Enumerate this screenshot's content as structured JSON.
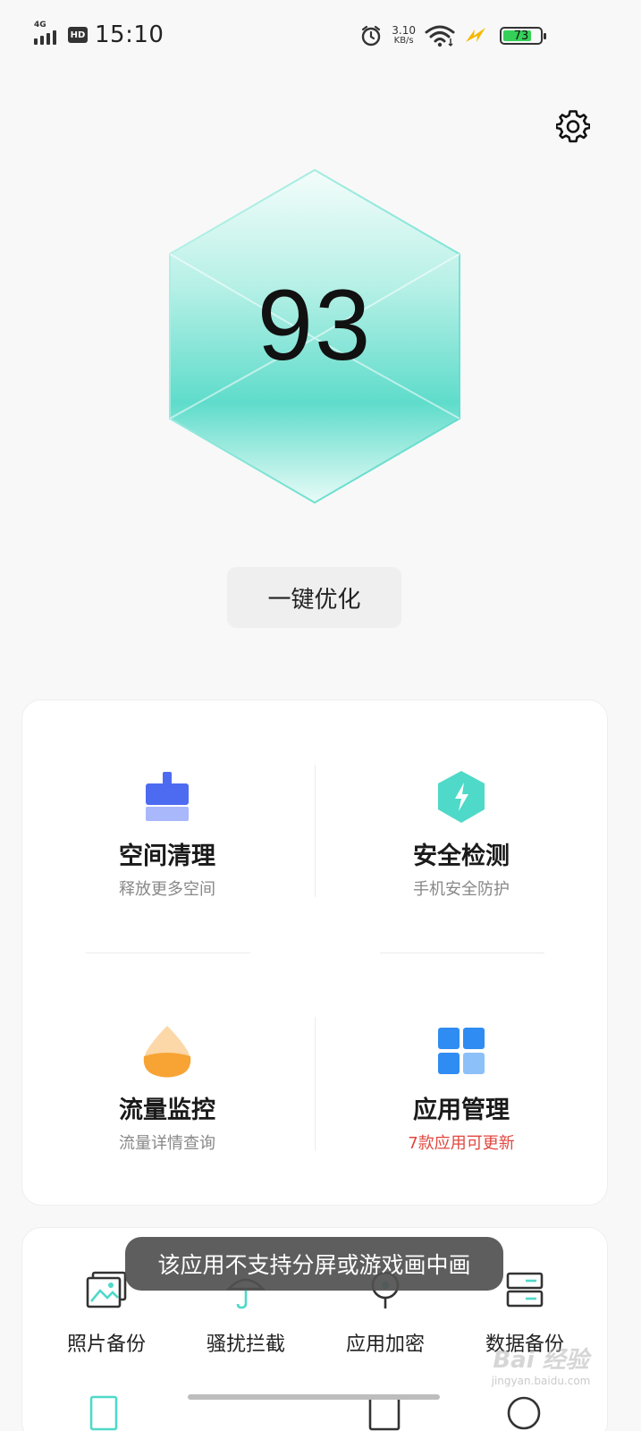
{
  "status_bar": {
    "network": "4G",
    "hd": "HD",
    "time": "15:10",
    "speed_value": "3.10",
    "speed_unit": "KB/s",
    "battery": "73"
  },
  "score": {
    "value": "93",
    "optimize_label": "一键优化"
  },
  "features": [
    {
      "title": "空间清理",
      "subtitle": "释放更多空间",
      "icon": "broom-icon"
    },
    {
      "title": "安全检测",
      "subtitle": "手机安全防护",
      "icon": "shield-bolt-icon"
    },
    {
      "title": "流量监控",
      "subtitle": "流量详情查询",
      "icon": "drop-icon"
    },
    {
      "title": "应用管理",
      "subtitle": "7款应用可更新",
      "icon": "grid-icon"
    }
  ],
  "tools": [
    {
      "label": "照片备份",
      "icon": "photo-icon"
    },
    {
      "label": "骚扰拦截",
      "icon": "umbrella-icon"
    },
    {
      "label": "应用加密",
      "icon": "lock-icon"
    },
    {
      "label": "数据备份",
      "icon": "storage-icon"
    }
  ],
  "toast": "该应用不支持分屏或游戏画中画",
  "watermark": {
    "main": "Bai 经验",
    "sub": "jingyan.baidu.com"
  },
  "colors": {
    "accent_teal": "#4fd9c8",
    "clean_blue": "#4d6bf0",
    "drop_orange": "#f7a435",
    "grid_blue": "#2f8cf2",
    "alert_red": "#e0473f"
  }
}
